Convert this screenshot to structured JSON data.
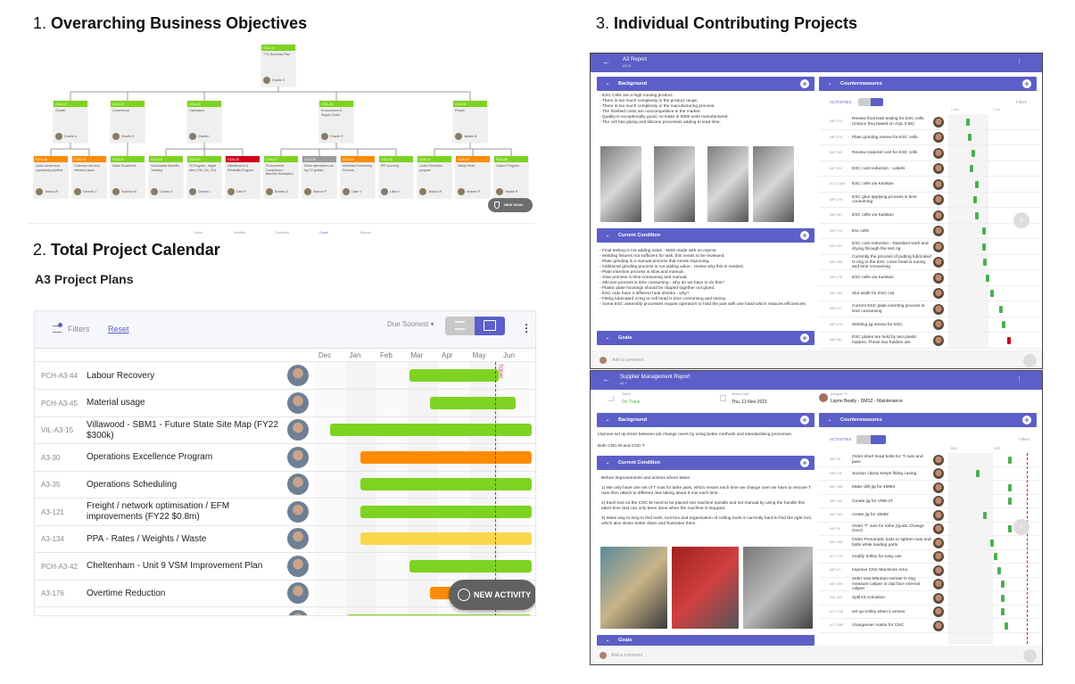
{
  "headings": {
    "h1_num": "1.",
    "h1": "Overarching Business Objectives",
    "h2_num": "2.",
    "h2": "Total Project Calendar",
    "h3_num": "3.",
    "h3": "Individual Contributing Projects"
  },
  "colors": {
    "green": "#7ed321",
    "orange": "#ff8c00",
    "red": "#d0021b",
    "grey": "#9b9b9b",
    "yellow": "#f8d84a",
    "purple": "#5b5fc7",
    "today": "#c62828"
  },
  "org": {
    "root": {
      "id": "GOA-16",
      "title": "TTG Business Plan",
      "owner": "Charlie S",
      "status": "green"
    },
    "level2": [
      {
        "id": "GOA-17",
        "title": "Growth",
        "owner": "Charlie A",
        "status": "green"
      },
      {
        "id": "GOA-20",
        "title": "Commercial",
        "owner": "Charlie S",
        "status": "green"
      },
      {
        "id": "GOA-22",
        "title": "Operations",
        "owner": "Charlie L",
        "status": "green"
      },
      {
        "id": "GOA-26",
        "title": "Procurement & Supply Chain",
        "owner": "Charlie S",
        "status": "green"
      },
      {
        "id": "GOA-31",
        "title": "People",
        "owner": "Natalie B",
        "status": "green"
      }
    ],
    "level3": [
      {
        "id": "GOA-18",
        "title": "Quick conversion opportunity pipeline",
        "owner": "Jessica R",
        "status": "orange",
        "parent": 0
      },
      {
        "id": "GOA-19",
        "title": "Customer risk and retention plans",
        "owner": "Hannah C",
        "status": "orange",
        "parent": 0
      },
      {
        "id": "GOA-21",
        "title": "Sales Excellence",
        "owner": "Siobhan M",
        "status": "green",
        "parent": 1
      },
      {
        "id": "GOA-23",
        "title": "Sustainable Benefits Tracking",
        "owner": "Charlie A",
        "status": "green",
        "parent": 2
      },
      {
        "id": "GOA-24",
        "title": "To Program - target sites (VIA, UK, CH)",
        "owner": "Charlie L",
        "status": "green",
        "parent": 2
      },
      {
        "id": "GOA-25",
        "title": "Maintenance & Reliability Program",
        "owner": "Dale R",
        "status": "red",
        "parent": 2
      },
      {
        "id": "GOA-27",
        "title": "Procurement Compliance / Benefits Realisation",
        "owner": "Bradley S",
        "status": "green",
        "parent": 3
      },
      {
        "id": "GOA-28",
        "title": "Resin alternatives for top 10 grades",
        "owner": "Marcus P",
        "status": "grey",
        "parent": 3
      },
      {
        "id": "GOA-29",
        "title": "Materials Purchasing Process",
        "owner": "Lilian V",
        "status": "orange",
        "parent": 3
      },
      {
        "id": "GOA-30",
        "title": "IPP sourcing",
        "owner": "Lilian V",
        "status": "green",
        "parent": 3
      },
      {
        "id": "GOA-32",
        "title": "Lease Reduction program",
        "owner": "Jessica R",
        "status": "green",
        "parent": 4
      },
      {
        "id": "GOA-34",
        "title": "Safety Heart",
        "owner": "Andrew P",
        "status": "orange",
        "parent": 4
      },
      {
        "id": "GOA-35",
        "title": "Culture Program",
        "owner": "Natalie B",
        "status": "green",
        "parent": 4
      }
    ],
    "nav": [
      "Guide",
      "Activities",
      "Checklists",
      "Goals",
      "Reports"
    ],
    "nav_active": 3,
    "new_goal": "NEW GOAL"
  },
  "calendar": {
    "title": "A3 Project Plans",
    "filters": "Filters",
    "reset": "Reset",
    "sort": "Due Soonest",
    "months": [
      "Dec",
      "Jan",
      "Feb",
      "Mar",
      "Apr",
      "May",
      "Jun"
    ],
    "today": "May 27",
    "today_label": "TODAY",
    "new_activity": "NEW ACTIVITY",
    "rows": [
      {
        "id": "PCH-A3-44",
        "name": "Labour Recovery",
        "start": "Mar 03",
        "end": "May 30",
        "status": "green"
      },
      {
        "id": "PCH-A3-45",
        "name": "Material usage",
        "start": "Mar 23",
        "end": "Jun 17",
        "status": "green"
      },
      {
        "id": "VIL-A3-15",
        "name": "Villawood - SBM1 - Future State Site Map (FY22 $300k)",
        "start": "Dec 16",
        "end": "Jul 02",
        "status": "green"
      },
      {
        "id": "A3-30",
        "name": "Operations Excellence Program",
        "start": "Jan 15",
        "end": "Jul 02",
        "status": "orange"
      },
      {
        "id": "A3-35",
        "name": "Operations Scheduling",
        "start": "Jan 15",
        "end": "Jul 02",
        "status": "green"
      },
      {
        "id": "A3-121",
        "name": "Freight / network optimisation / EFM improvements (FY22 $0.8m)",
        "start": "Jan 15",
        "end": "Jul 02",
        "status": "green"
      },
      {
        "id": "A3-134",
        "name": "PPA - Rates / Weights / Waste",
        "start": "Jan 15",
        "end": "Jul 02",
        "status": "yellow"
      },
      {
        "id": "PCH-A3-42",
        "name": "Cheltenham - Unit 9 VSM Improvement Plan",
        "start": "Mar 03",
        "end": "Jul 02",
        "status": "green"
      },
      {
        "id": "A3-176",
        "name": "Overtime Reduction",
        "start": "Mar 23",
        "end": "Jul 02",
        "status": "orange"
      },
      {
        "id": "",
        "name": "",
        "start": "Jan 01",
        "end": "Jul 02",
        "status": "green"
      }
    ]
  },
  "a3": {
    "title": "A3 Report",
    "sub": "A3-12",
    "background_label": "Background",
    "background": [
      "- ESC Cells are a high moving product.",
      "- There is too much complexity in the product range.",
      "- There is too much complexity in the manufacturing process.",
      "- The finished costs are noncompetitive in the market.",
      "- Quality is exceptionally good, no leaks in 6500 units manufactured.",
      "- The cell has gluing and silicone processes adding to lead time."
    ],
    "current_label": "Current Condition",
    "current": [
      "- Final testing is not adding value - 6500 made with no rejects.",
      "- Welding fixtures not sufficient for task, this needs to be reviewed.",
      "- Plate grinding is a manual process that needs improving.",
      "- Additional grinding process is not adding value - review why this is needed.",
      "- Plate insertion process is slow and manual.",
      "- Glue process is time consuming and manual.",
      "- Silicone process is time consuming - why do we have to do this?",
      "- Plastic plate housings should be clipped together not glued.",
      "- ESC rods have 3 different heat shrinks - why?",
      "- Fitting lubricated o'ring to cell head is time consuming and messy.",
      "- Some ESC assembly processes require operators to hold the part with one hand which reduces efficiencies."
    ],
    "goals_label": "Goals",
    "counter_label": "Countermeasures",
    "activities": "ACTIVITIES",
    "filters": "Filters",
    "axis": [
      "1 Jan",
      "1 Jul"
    ],
    "comment": "Add a comment",
    "rows": [
      {
        "id": "IMP-373",
        "name": "Review final leak testing for ESC cells (reduce freq based on AQL 0.65)",
        "date": "Mar 01",
        "status": "green"
      },
      {
        "id": "IMP-375",
        "name": "Plate grinding review for ESC cells",
        "date": "Mar 10",
        "status": "green"
      },
      {
        "id": "IMP-380",
        "name": "Review material cost for ESC cells",
        "date": "Mar 25",
        "status": "green"
      },
      {
        "id": "IMP-422",
        "name": "ESC cost reduction - Labels",
        "date": "Mar 19",
        "status": "green"
      },
      {
        "id": "ACT-1459",
        "name": "ESC cells via KanBan",
        "date": "Apr 10",
        "status": "green"
      },
      {
        "id": "IMP-376",
        "name": "ESC glue applying process is time consuming",
        "date": "Apr 04",
        "status": "green"
      },
      {
        "id": "IMP-387",
        "name": "ESC cells via KanBan",
        "date": "Apr 10",
        "status": "green"
      },
      {
        "id": "IMP-211",
        "name": "Esc cells",
        "date": "May 10",
        "status": "green"
      },
      {
        "id": "IMP-421",
        "name": "ESC cost reduction - Standard work and drying through the test rig",
        "date": "May 10",
        "status": "green"
      },
      {
        "id": "IMP-385",
        "name": "Currently the process of putting lubricated O ring to the ESC cover head is messy and time consuming",
        "date": "May 16",
        "status": "green"
      },
      {
        "id": "IMP-478",
        "name": "ESC cells via KanBan",
        "date": "May 28",
        "status": "green"
      },
      {
        "id": "IMP-409",
        "name": "Slot width for ESC rod",
        "date": "Jun 16",
        "status": "green"
      },
      {
        "id": "IMP-377",
        "name": "Current ESC plate inserting process is time consuming",
        "date": "Jul 25",
        "status": "green"
      },
      {
        "id": "IMP-374",
        "name": "Welding jig review for ESC",
        "date": "Aug 04",
        "status": "green"
      },
      {
        "id": "IMP-381",
        "name": "ESC plates are held by two plastic holders. These two holders are",
        "date": "Aug 28",
        "status": "red"
      }
    ]
  },
  "smr": {
    "title": "Supplier Management Report",
    "sub": "A3-7",
    "status_label": "Status",
    "status": "On Track",
    "review_label": "Review Date",
    "review": "Thu, 11-Nov-2021",
    "assigned_label": "Assigned To",
    "assigned": "Layne Beatty - DMS2 - Maintenance",
    "background_label": "Background",
    "background": [
      "Improve set up times between job change overs by using better methods and standardising processes.",
      "Both CNC-M and CNC-T"
    ],
    "current_label": "Current Condition",
    "current": [
      "Before Improvements and actions where taken.",
      "1) We only have one set of T nuts for lathe jaws, which means each time we change over we have to remove T nuts then attach to different Jaw taking about 5 min each time.",
      "2) Each tool on the CNC-M need to be placed into machine spindle and set manual by using the handle this takes time and can only been done when the machine is stopped.",
      "3) takes way to long to find tools, tool box and organisation of cutting tools is currently hard to find the right tool, which also slows Setter down and frustrates them."
    ],
    "goals_label": "Goals",
    "counter_label": "Countermeasures",
    "activities": "ACTIVITIES",
    "filters": "Filters",
    "axis": [
      "2020",
      "2021"
    ],
    "today": "2021-10",
    "comment": "Add a comment",
    "rows": [
      {
        "id": "IMP-92",
        "name": "Order short head bolts for 'T nuts and jaws",
        "start": "2021-05",
        "end": "2021-05"
      },
      {
        "id": "IMP-111",
        "name": "Suction clamp keeps fitting casing",
        "start": "2020-08",
        "end": "2021-05"
      },
      {
        "id": "IMP-108",
        "name": "Make drill jig for 45984",
        "start": "2021-05",
        "end": "2021-05"
      },
      {
        "id": "IMP-106",
        "name": "Create jig for VM5-4T",
        "start": "2021-05",
        "end": "2021-05"
      },
      {
        "id": "IMP-103",
        "name": "create jig for 15682",
        "start": "2020-10",
        "end": "2021-05"
      },
      {
        "id": "IMP-90",
        "name": "Order 'T' nuts for lathe (Quick Change Over)",
        "start": "2021-05",
        "end": "2021-05"
      },
      {
        "id": "IMP-188",
        "name": "Order Pneumatic tools to tighten nuts and bolts while loading parts",
        "start": "2020-12",
        "end": "2021-01"
      },
      {
        "id": "ACT-721",
        "name": "modify trolley for easy use",
        "start": "2021-01",
        "end": "2021-01"
      },
      {
        "id": "IMP-97",
        "name": "Improve CNC Machines Area",
        "start": "2021-02",
        "end": "2021-02"
      },
      {
        "id": "IMP-209",
        "name": "order new Mitutoyo vernier D ring measure caliper or dial face internal caliper",
        "start": "2021-03",
        "end": "2021-03"
      },
      {
        "id": "INC-503",
        "name": "Spill kit Activation",
        "start": "2021-03",
        "end": "2021-03"
      },
      {
        "id": "ACT-728",
        "name": "set up trolley when it arrives",
        "start": "2021-03",
        "end": "2021-03"
      },
      {
        "id": "ACT-555",
        "name": "changeover matrix for CNC",
        "start": "2021-04",
        "end": "2021-04"
      }
    ]
  }
}
